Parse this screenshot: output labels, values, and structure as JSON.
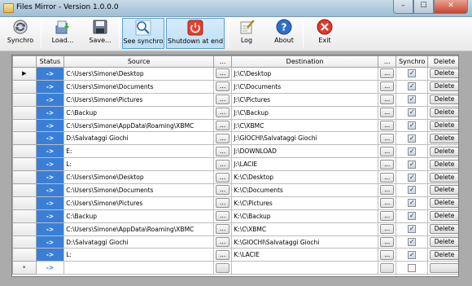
{
  "window": {
    "title": "Files Mirror - Version 1.0.0.0",
    "min": "–",
    "max": "☐",
    "close": "✕"
  },
  "toolbar": {
    "synchro": "Synchro",
    "load": "Load...",
    "save": "Save...",
    "see_synchro": "See synchro",
    "shutdown": "Shutdown at end",
    "log": "Log",
    "about": "About",
    "exit": "Exit"
  },
  "columns": {
    "status": "Status",
    "source": "Source",
    "browse_source": "...",
    "destination": "Destination",
    "browse_dest": "...",
    "synchro": "Synchro",
    "delete": "Delete"
  },
  "row_button_label": "...",
  "delete_label": "Delete",
  "check_mark": "✓",
  "rows": [
    {
      "marker": "▶",
      "status": "->",
      "source": "C:\\Users\\Simone\\Desktop",
      "destination": "J:\\C\\Desktop",
      "synchro": true
    },
    {
      "marker": "",
      "status": "->",
      "source": "C:\\Users\\Simone\\Documents",
      "destination": "J:\\C\\Documents",
      "synchro": true
    },
    {
      "marker": "",
      "status": "->",
      "source": "C:\\Users\\Simone\\Pictures",
      "destination": "J:\\C\\Pictures",
      "synchro": true
    },
    {
      "marker": "",
      "status": "->",
      "source": "C:\\Backup",
      "destination": "J:\\C\\Backup",
      "synchro": true
    },
    {
      "marker": "",
      "status": "->",
      "source": "C:\\Users\\Simone\\AppData\\Roaming\\XBMC",
      "destination": "J:\\C\\XBMC",
      "synchro": true
    },
    {
      "marker": "",
      "status": "->",
      "source": "D:\\Salvataggi Giochi",
      "destination": "J:\\GIOCHI\\Salvataggi Giochi",
      "synchro": true
    },
    {
      "marker": "",
      "status": "->",
      "source": "E:",
      "destination": "J:\\DOWNLOAD",
      "synchro": true
    },
    {
      "marker": "",
      "status": "->",
      "source": "L:",
      "destination": "J:\\LACIE",
      "synchro": true
    },
    {
      "marker": "",
      "status": "->",
      "source": "C:\\Users\\Simone\\Desktop",
      "destination": "K:\\C\\Desktop",
      "synchro": true
    },
    {
      "marker": "",
      "status": "->",
      "source": "C:\\Users\\Simone\\Documents",
      "destination": "K:\\C\\Documents",
      "synchro": true
    },
    {
      "marker": "",
      "status": "->",
      "source": "C:\\Users\\Simone\\Pictures",
      "destination": "K:\\C\\Pictures",
      "synchro": true
    },
    {
      "marker": "",
      "status": "->",
      "source": "C:\\Backup",
      "destination": "K:\\C\\Backup",
      "synchro": true
    },
    {
      "marker": "",
      "status": "->",
      "source": "C:\\Users\\Simone\\AppData\\Roaming\\XBMC",
      "destination": "K:\\C\\XBMC",
      "synchro": true
    },
    {
      "marker": "",
      "status": "->",
      "source": "D:\\Salvataggi Giochi",
      "destination": "K:\\GIOCHI\\Salvataggi Giochi",
      "synchro": true
    },
    {
      "marker": "",
      "status": "->",
      "source": "L:",
      "destination": "K:\\LACIE",
      "synchro": true
    }
  ],
  "new_row": {
    "marker": "*",
    "status": "->"
  },
  "colors": {
    "status_bg": "#3a7fd7",
    "frame_bg": "#ababab"
  }
}
